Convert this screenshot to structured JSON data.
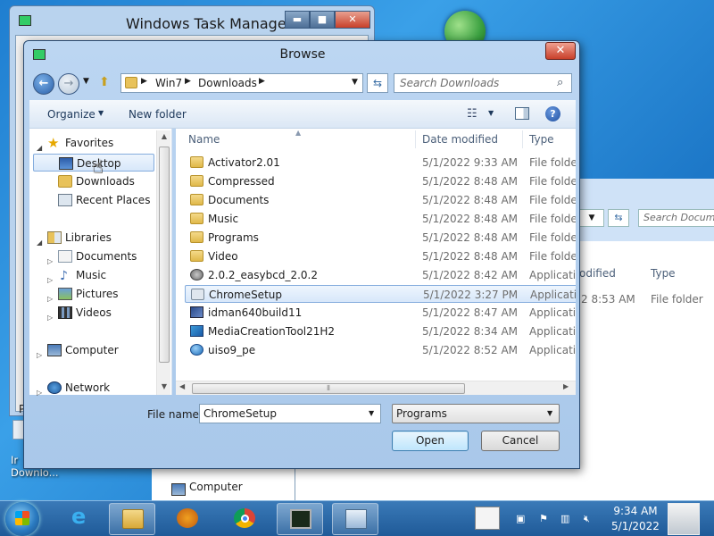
{
  "desktop": {
    "icon_label": "Ir\nDownlo..."
  },
  "task_manager": {
    "title": "Windows Task Manager",
    "fragment": "P"
  },
  "explorer_behind": {
    "search_placeholder": "Search Docume",
    "col_date": "odified",
    "col_type": "Type",
    "row_date": "2 8:53 AM",
    "row_type": "File folder",
    "left_item": "Computer"
  },
  "dialog": {
    "title": "Browse",
    "close_label": "✕",
    "address": {
      "parts": [
        "Win7",
        "Downloads"
      ]
    },
    "search_placeholder": "Search Downloads",
    "toolbar": {
      "organize": "Organize",
      "new_folder": "New folder"
    },
    "nav": {
      "favorites": "Favorites",
      "desktop": "Desktop",
      "downloads": "Downloads",
      "recent_places": "Recent Places",
      "libraries": "Libraries",
      "documents": "Documents",
      "music": "Music",
      "pictures": "Pictures",
      "videos": "Videos",
      "computer": "Computer",
      "network": "Network"
    },
    "columns": {
      "name": "Name",
      "date": "Date modified",
      "type": "Type"
    },
    "files": [
      {
        "name": "Activator2.01",
        "date": "5/1/2022 9:33 AM",
        "type": "File folder",
        "icon": "folder-icon"
      },
      {
        "name": "Compressed",
        "date": "5/1/2022 8:48 AM",
        "type": "File folder",
        "icon": "folder-icon"
      },
      {
        "name": "Documents",
        "date": "5/1/2022 8:48 AM",
        "type": "File folder",
        "icon": "folder-icon"
      },
      {
        "name": "Music",
        "date": "5/1/2022 8:48 AM",
        "type": "File folder",
        "icon": "folder-icon"
      },
      {
        "name": "Programs",
        "date": "5/1/2022 8:48 AM",
        "type": "File folder",
        "icon": "folder-icon"
      },
      {
        "name": "Video",
        "date": "5/1/2022 8:48 AM",
        "type": "File folder",
        "icon": "folder-icon"
      },
      {
        "name": "2.0.2_easybcd_2.0.2",
        "date": "5/1/2022 8:42 AM",
        "type": "Application",
        "icon": "easybcd-icon"
      },
      {
        "name": "ChromeSetup",
        "date": "5/1/2022 3:27 PM",
        "type": "Application",
        "icon": "chrome-setup-icon",
        "selected": true
      },
      {
        "name": "idman640build11",
        "date": "5/1/2022 8:47 AM",
        "type": "Application",
        "icon": "idm-icon"
      },
      {
        "name": "MediaCreationTool21H2",
        "date": "5/1/2022 8:34 AM",
        "type": "Application",
        "icon": "media-creation-icon"
      },
      {
        "name": "uiso9_pe",
        "date": "5/1/2022 8:52 AM",
        "type": "Application",
        "icon": "ultraiso-icon"
      }
    ],
    "file_name_label": "File name:",
    "file_name_value": "ChromeSetup",
    "file_type_value": "Programs",
    "open_label": "Open",
    "cancel_label": "Cancel"
  },
  "taskbar": {
    "time": "9:34 AM",
    "date": "5/1/2022",
    "items": [
      "internet-explorer",
      "windows-explorer",
      "media-player",
      "chrome",
      "task-manager",
      "browse-dialog"
    ]
  },
  "colors": {
    "accent": "#3c7fb1",
    "selection": "#d7e7fa",
    "titlebar": "#bcd6f2",
    "taskbar": "#1f5a98"
  }
}
